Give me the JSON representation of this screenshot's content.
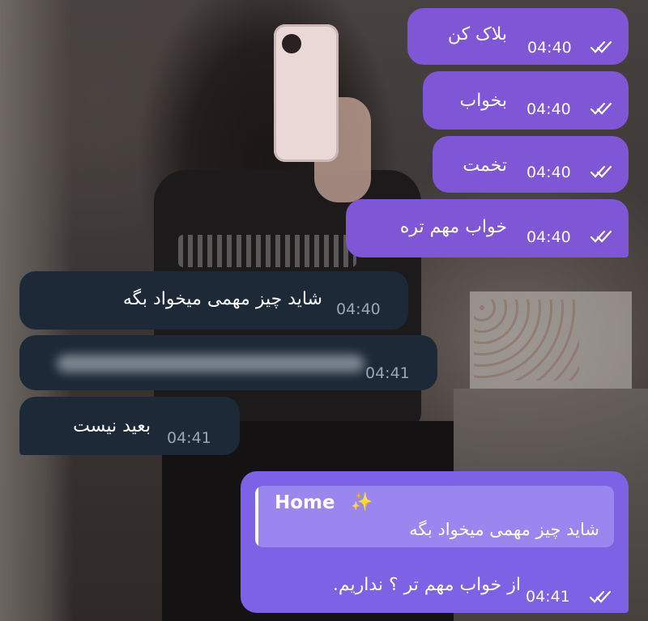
{
  "chat": {
    "outgoing": [
      {
        "text": "بلاک کن",
        "time": "04:40"
      },
      {
        "text": "بخواب",
        "time": "04:40"
      },
      {
        "text": "تخمت",
        "time": "04:40"
      },
      {
        "text": "خواب مهم تره",
        "time": "04:40"
      }
    ],
    "incoming": [
      {
        "text": "شاید چیز مهمی میخواد بگه",
        "time": "04:40"
      },
      {
        "text": "",
        "time": "04:41"
      },
      {
        "text": "بعید نیست",
        "time": "04:41"
      }
    ],
    "reply": {
      "quoted_name": "Home",
      "quoted_icon": "✨",
      "quoted_text": "شاید چیز مهمی میخواد بگه",
      "text": "از خواب مهم تر ؟ نداریم.",
      "time": "04:41"
    }
  },
  "icons": {
    "read_receipt": "double-check-icon",
    "sparkle": "sparkle-icon"
  },
  "colors": {
    "outgoing_bubble": "#7f56d6",
    "reply_bubble": "#7d62e6",
    "incoming_bubble": "#1d2937",
    "incoming_time": "#9aa6b2"
  }
}
